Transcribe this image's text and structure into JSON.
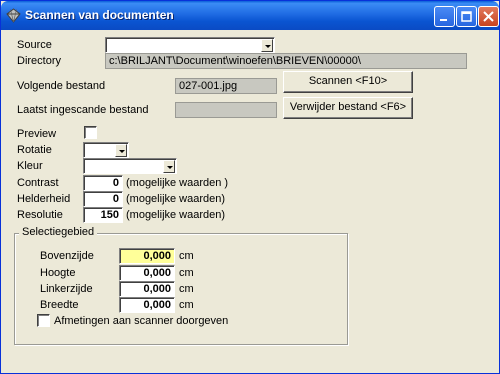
{
  "window": {
    "title": "Scannen van documenten"
  },
  "form": {
    "source": {
      "label": "Source",
      "value": ""
    },
    "directory": {
      "label": "Directory",
      "value": "c:\\BRILJANT\\Document\\winoefen\\BRIEVEN\\00000\\"
    },
    "next_file": {
      "label": "Volgende bestand",
      "value": "027-001.jpg"
    },
    "last_scanned": {
      "label": "Laatst ingescande bestand",
      "value": ""
    },
    "preview": {
      "label": "Preview"
    },
    "rotation": {
      "label": "Rotatie",
      "value": ""
    },
    "color": {
      "label": "Kleur",
      "value": ""
    },
    "contrast": {
      "label": "Contrast",
      "value": "0",
      "hint": "(mogelijke waarden )"
    },
    "brightness": {
      "label": "Helderheid",
      "value": "0",
      "hint": "(mogelijke waarden)"
    },
    "resolution": {
      "label": "Resolutie",
      "value": "150",
      "hint": "(mogelijke waarden)"
    }
  },
  "buttons": {
    "scan": "Scannen <F10>",
    "delete": "Verwijder bestand <F6>"
  },
  "selection": {
    "title": "Selectiegebied",
    "unit": "cm",
    "top": {
      "label": "Bovenzijde",
      "value": "0,000"
    },
    "height": {
      "label": "Hoogte",
      "value": "0,000"
    },
    "left": {
      "label": "Linkerzijde",
      "value": "0,000"
    },
    "width": {
      "label": "Breedte",
      "value": "0,000"
    },
    "pass_to_scanner": {
      "label": "Afmetingen aan scanner doorgeven"
    }
  }
}
